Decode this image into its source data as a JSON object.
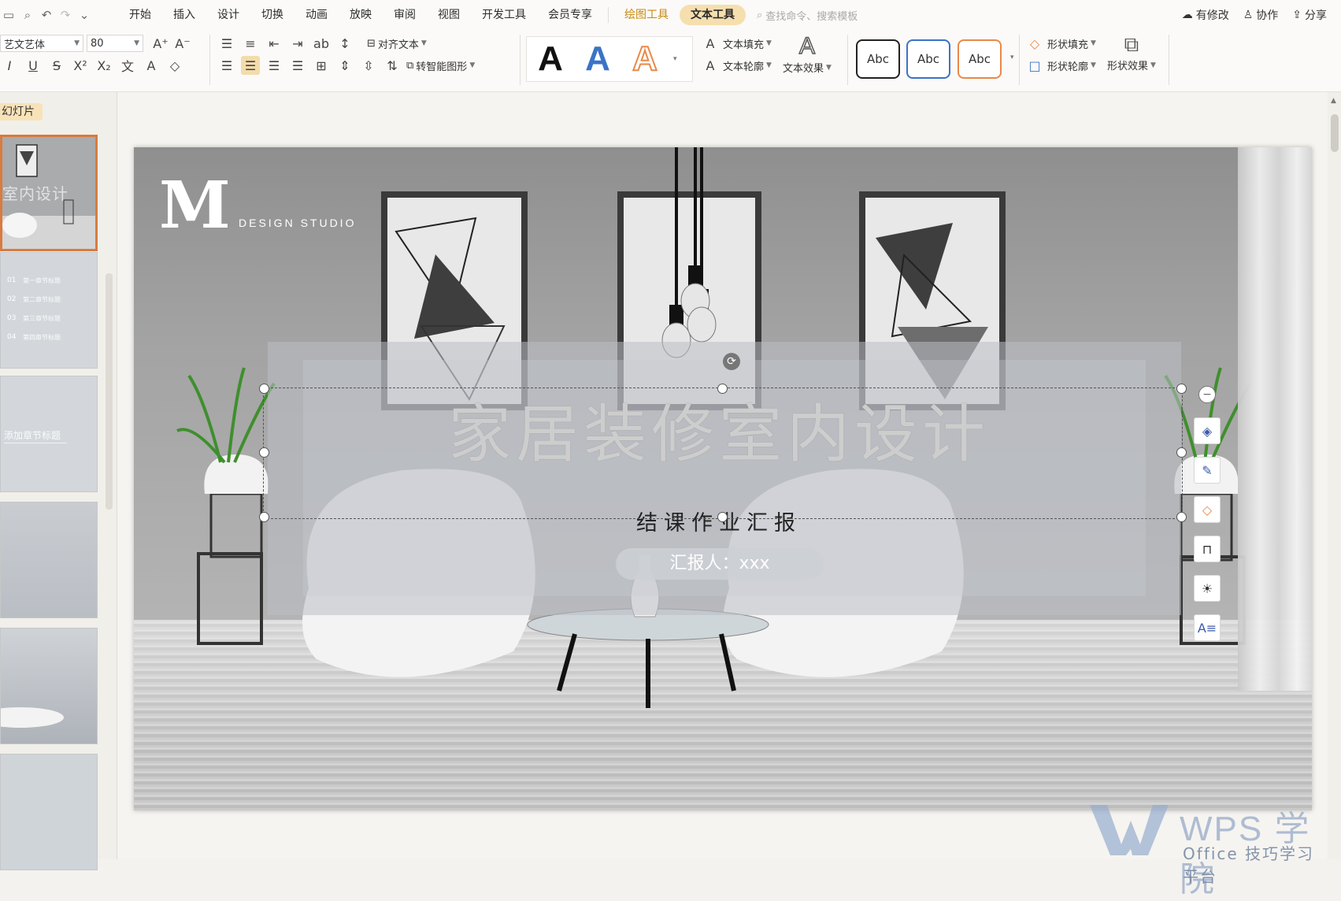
{
  "quick_access": {
    "icons": [
      "save-icon",
      "print-preview-icon",
      "undo-icon",
      "redo-icon",
      "more-icon"
    ]
  },
  "menu": {
    "tabs": [
      {
        "label": "开始"
      },
      {
        "label": "插入"
      },
      {
        "label": "设计"
      },
      {
        "label": "切换"
      },
      {
        "label": "动画"
      },
      {
        "label": "放映"
      },
      {
        "label": "审阅"
      },
      {
        "label": "视图"
      },
      {
        "label": "开发工具"
      },
      {
        "label": "会员专享"
      }
    ],
    "draw_tools": "绘图工具",
    "text_tools": "文本工具",
    "search_placeholder": "查找命令、搜索模板",
    "right": {
      "modified": "有修改",
      "collab": "协作",
      "share": "分享"
    }
  },
  "ribbon": {
    "font_name": "艺文艺体",
    "font_size": "80",
    "align_text": "对齐文本",
    "smart_shape": "转智能图形",
    "art_styles": [
      "A",
      "A",
      "A"
    ],
    "text_fill": "文本填充",
    "text_outline": "文本轮廓",
    "text_effect": "文本效果",
    "shape_styles": [
      "Abc",
      "Abc",
      "Abc"
    ],
    "shape_fill": "形状填充",
    "shape_outline": "形状轮廓",
    "shape_effect": "形状效果"
  },
  "left_pane": {
    "label": "幻灯片",
    "thumbs": [
      {
        "title": "室内设计"
      },
      {
        "rows": [
          {
            "num": "01",
            "text": "第一章节标题"
          },
          {
            "num": "02",
            "text": "第二章节标题"
          },
          {
            "num": "03",
            "text": "第三章节标题"
          },
          {
            "num": "04",
            "text": "第四章节标题"
          }
        ]
      },
      {
        "title": "添加章节标题"
      },
      {
        "title": ""
      },
      {
        "title": ""
      },
      {
        "title": ""
      }
    ]
  },
  "slide": {
    "logo_letter": "M",
    "logo_sub": "DESIGN STUDIO",
    "title": "家居装修室内设计",
    "subtitle": "结课作业汇报",
    "reporter": "汇报人：xxx"
  },
  "float_toolbar": [
    "layers-icon",
    "brush-icon",
    "fill-icon",
    "border-icon",
    "idea-icon",
    "text-style-icon"
  ],
  "watermark": {
    "brand": "WPS 学院",
    "tagline": "Office 技巧学习平台"
  },
  "colors": {
    "accent": "#d97b3e",
    "tab_active": "#f6dfae",
    "draw_tab": "#c98a12",
    "blue": "#3b73c7",
    "orange": "#e9894a"
  }
}
